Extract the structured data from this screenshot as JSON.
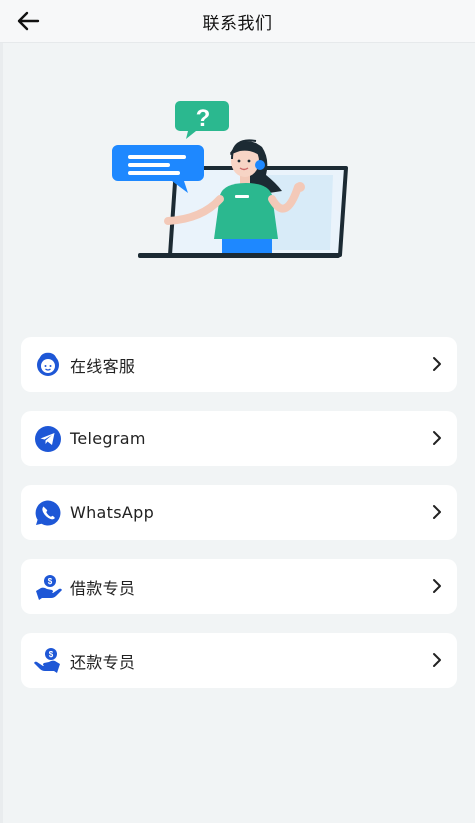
{
  "header": {
    "title": "联系我们",
    "back_icon": "arrow-left-icon"
  },
  "colors": {
    "accent": "#1e57d6",
    "bubble_blue": "#1e88ff",
    "bubble_green": "#2bb88f",
    "page_bg": "#f1f4f5"
  },
  "items": [
    {
      "label": "在线客服",
      "icon": "customer-service-icon"
    },
    {
      "label": "Telegram",
      "icon": "telegram-icon"
    },
    {
      "label": "WhatsApp",
      "icon": "whatsapp-icon"
    },
    {
      "label": "借款专员",
      "icon": "loan-officer-icon"
    },
    {
      "label": "还款专员",
      "icon": "repayment-officer-icon"
    }
  ],
  "hero": {
    "bubble_symbol": "?"
  }
}
